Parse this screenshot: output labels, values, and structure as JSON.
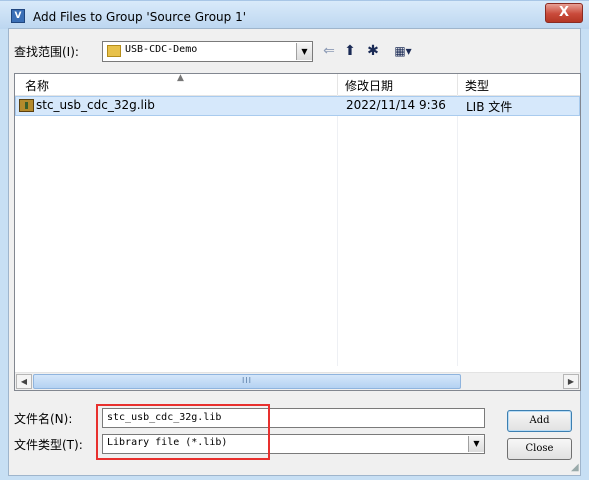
{
  "window": {
    "title": "Add Files to Group 'Source Group 1'",
    "icon_glyph": "V",
    "close_glyph": "X"
  },
  "toolbar": {
    "look_in_label": "查找范围(I):",
    "look_in_value": "USB-CDC-Demo",
    "icons": [
      "back-arrow-icon",
      "up-folder-icon",
      "new-folder-icon",
      "view-menu-icon"
    ],
    "back_glyph": "⇐",
    "up_glyph": "⬆",
    "new_folder_glyph": "✱",
    "view_glyph": "▦▾"
  },
  "file_list": {
    "columns": [
      "名称",
      "修改日期",
      "类型"
    ],
    "rows": [
      {
        "name": "stc_usb_cdc_32g.lib",
        "modified": "2022/11/14 9:36",
        "type": "LIB 文件",
        "selected": true
      }
    ]
  },
  "scrollbar": {
    "thumb_grip": "III"
  },
  "fields": {
    "filename_label": "文件名(N):",
    "filename_value": "stc_usb_cdc_32g.lib",
    "filetype_label": "文件类型(T):",
    "filetype_value": "Library file (*.lib)"
  },
  "buttons": {
    "add": "Add",
    "close": "Close"
  },
  "colors": {
    "window_frame": "#c7dff4",
    "client_bg": "#f0f0f0",
    "selection": "#d6e8fb",
    "highlight_box": "#e8302e",
    "close_button": "#c94a3a"
  }
}
